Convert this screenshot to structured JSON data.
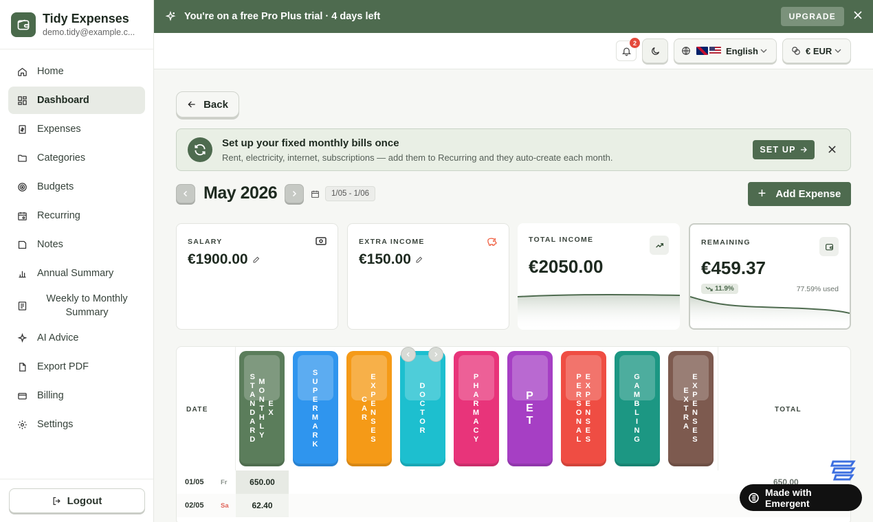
{
  "app": {
    "name": "Tidy Expenses",
    "email": "demo.tidy@example.c..."
  },
  "sidebar": {
    "items": [
      {
        "label": "Home",
        "icon": "home-icon"
      },
      {
        "label": "Dashboard",
        "icon": "dashboard-icon",
        "active": true
      },
      {
        "label": "Expenses",
        "icon": "receipt-icon"
      },
      {
        "label": "Categories",
        "icon": "folder-icon"
      },
      {
        "label": "Budgets",
        "icon": "target-icon"
      },
      {
        "label": "Recurring",
        "icon": "calendar-recurring-icon"
      },
      {
        "label": "Notes",
        "icon": "note-icon"
      },
      {
        "label": "Annual Summary",
        "icon": "bar-chart-icon"
      },
      {
        "label": "Weekly to Monthly Summary",
        "icon": "summary-icon"
      },
      {
        "label": "AI Advice",
        "icon": "sparkles-icon"
      },
      {
        "label": "Export PDF",
        "icon": "file-icon"
      },
      {
        "label": "Billing",
        "icon": "credit-card-icon"
      },
      {
        "label": "Settings",
        "icon": "gear-icon"
      }
    ],
    "logout_label": "Logout"
  },
  "trial_banner": {
    "text": "You're on a free Pro Plus trial · 4 days left",
    "upgrade_label": "UPGRADE"
  },
  "topbar": {
    "notification_count": "2",
    "language": "English",
    "currency": "€ EUR"
  },
  "main": {
    "back_label": "Back",
    "setup": {
      "title": "Set up your fixed monthly bills once",
      "subtitle": "Rent, electricity, internet, subscriptions — add them to Recurring and they auto-create each month.",
      "button_label": "SET UP"
    },
    "month": "May 2026",
    "date_range": "1/05 - 1/06",
    "add_expense_label": "Add Expense",
    "cards": {
      "salary": {
        "label": "SALARY",
        "value": "€1900.00"
      },
      "extra_income": {
        "label": "EXTRA INCOME",
        "value": "€150.00"
      },
      "total_income": {
        "label": "TOTAL INCOME",
        "value": "€2050.00"
      },
      "remaining": {
        "label": "REMAINING",
        "value": "€459.37",
        "trend": "11.9%",
        "used": "77.59% used"
      }
    },
    "table": {
      "date_header": "DATE",
      "total_header": "TOTAL",
      "categories": [
        {
          "name": "STANDARD MONTHLY EX",
          "color": "#5b7d5b"
        },
        {
          "name": "SUPERMARK",
          "color": "#2f95ee"
        },
        {
          "name": "CAR EXPENSES",
          "color": "#f59a17"
        },
        {
          "name": "DOCTOR",
          "color": "#1dbfcf"
        },
        {
          "name": "PHARMACY",
          "color": "#e8347a"
        },
        {
          "name": "PET",
          "color": "#a63fc4"
        },
        {
          "name": "PERSONAL EXPENSES",
          "color": "#ef4d43"
        },
        {
          "name": "GAMBLING",
          "color": "#1c9783"
        },
        {
          "name": "EXTRA EXPENSES",
          "color": "#7d5a4f"
        }
      ],
      "rows": [
        {
          "date": "01/05",
          "weekday": "Fr",
          "value": "650.00",
          "total": "650.00"
        },
        {
          "date": "02/05",
          "weekday": "Sa",
          "value": "62.40",
          "total": ""
        }
      ]
    }
  },
  "badge": {
    "label": "Made with Emergent"
  },
  "colors": {
    "brand": "#4e6b4f",
    "accent_red": "#e44a3c"
  }
}
